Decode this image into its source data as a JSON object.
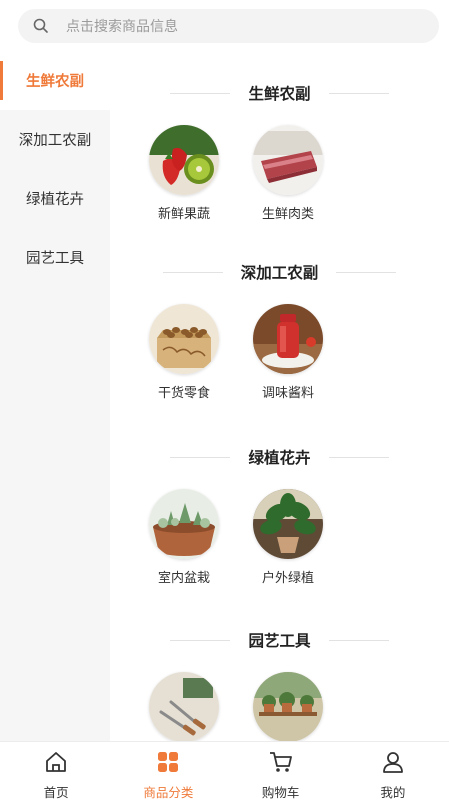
{
  "search": {
    "placeholder": "点击搜索商品信息"
  },
  "sidebar": {
    "items": [
      {
        "label": "生鲜农副"
      },
      {
        "label": "深加工农副"
      },
      {
        "label": "绿植花卉"
      },
      {
        "label": "园艺工具"
      }
    ]
  },
  "sections": [
    {
      "title": "生鲜农副",
      "tiles": [
        {
          "label": "新鲜果蔬",
          "icon": "fruit-image"
        },
        {
          "label": "生鲜肉类",
          "icon": "meat-image"
        }
      ]
    },
    {
      "title": "深加工农副",
      "tiles": [
        {
          "label": "干货零食",
          "icon": "nuts-image"
        },
        {
          "label": "调味酱料",
          "icon": "sauce-image"
        }
      ]
    },
    {
      "title": "绿植花卉",
      "tiles": [
        {
          "label": "室内盆栽",
          "icon": "succulent-image"
        },
        {
          "label": "户外绿植",
          "icon": "plant-image"
        }
      ]
    },
    {
      "title": "园艺工具",
      "tiles": [
        {
          "label": "",
          "icon": "tools-image"
        },
        {
          "label": "",
          "icon": "garden-shelf-image"
        }
      ]
    }
  ],
  "tabbar": {
    "items": [
      {
        "label": "首页",
        "icon": "home-icon"
      },
      {
        "label": "商品分类",
        "icon": "category-icon"
      },
      {
        "label": "购物车",
        "icon": "cart-icon"
      },
      {
        "label": "我的",
        "icon": "user-icon"
      }
    ]
  },
  "colors": {
    "accent": "#ef7a3a",
    "sidebar_bg": "#f6f6f6",
    "search_bg": "#f3f3f3"
  }
}
